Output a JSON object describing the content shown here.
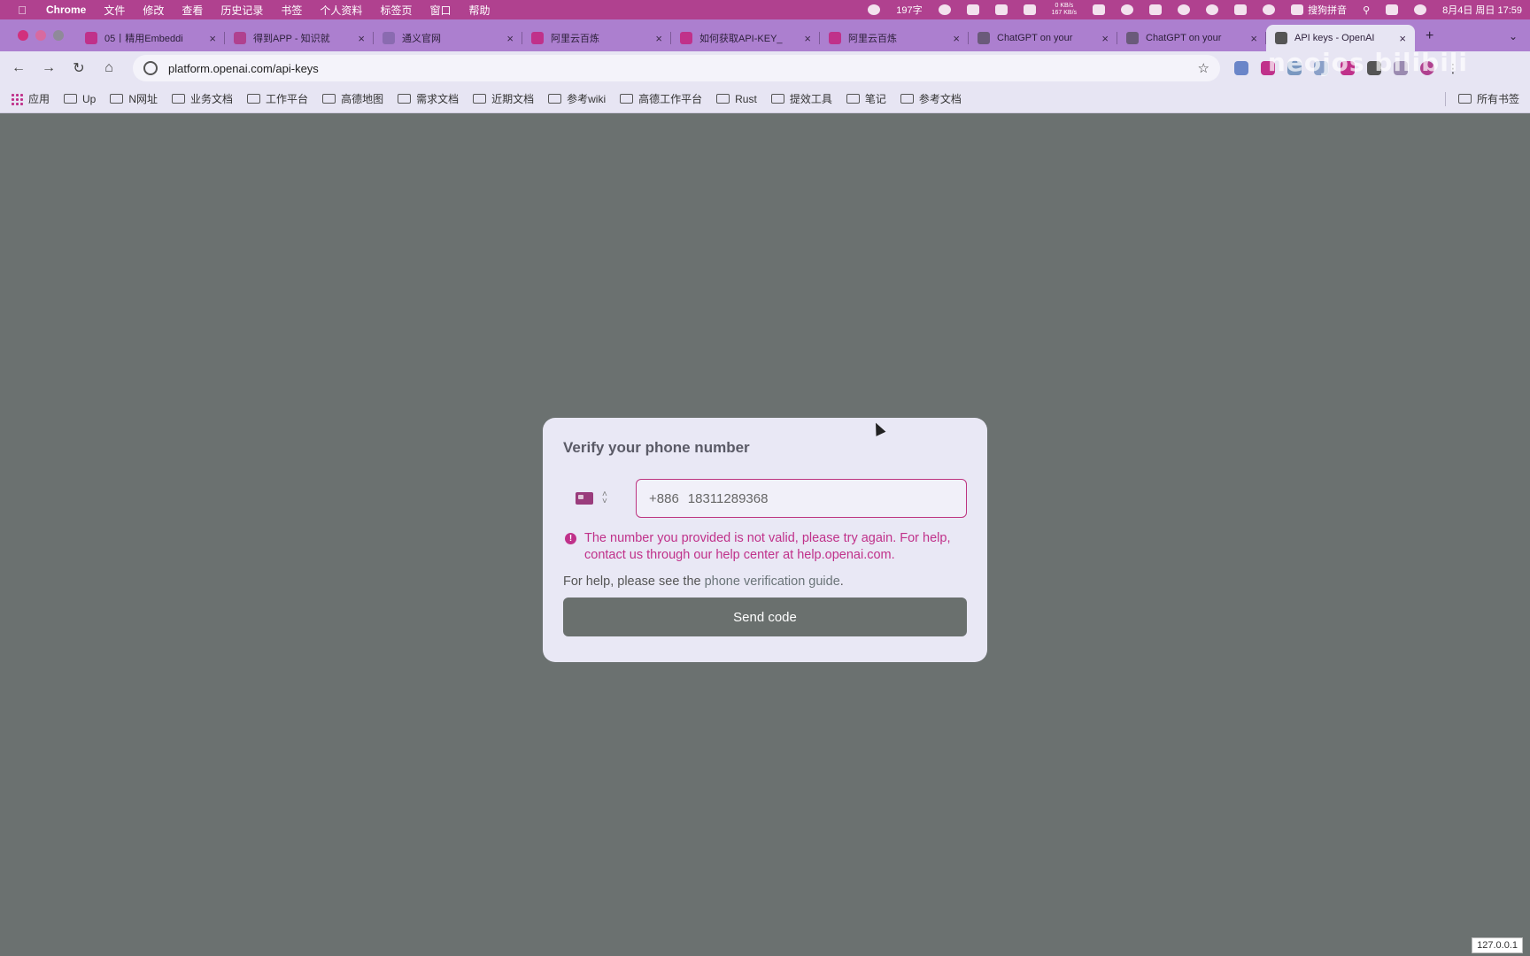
{
  "menubar": {
    "app": "Chrome",
    "items": [
      "文件",
      "修改",
      "查看",
      "历史记录",
      "书签",
      "个人资料",
      "标签页",
      "窗口",
      "帮助"
    ],
    "word_count": "197字",
    "input_method": "搜狗拼音",
    "net_up": "0 KB/s",
    "net_down": "167 KB/s",
    "datetime": "8月4日 周日  17:59"
  },
  "tabs": [
    {
      "title": "05丨精用Embeddi",
      "favicon_color": "#c0318a"
    },
    {
      "title": "得到APP - 知识就",
      "favicon_color": "#b0418f"
    },
    {
      "title": "通义官网",
      "favicon_color": "#8a6bb0"
    },
    {
      "title": "阿里云百炼",
      "favicon_color": "#c0318a"
    },
    {
      "title": "如何获取API-KEY_",
      "favicon_color": "#c0318a"
    },
    {
      "title": "阿里云百炼",
      "favicon_color": "#c0318a"
    },
    {
      "title": "ChatGPT on your",
      "favicon_color": "#6a5a7a"
    },
    {
      "title": "ChatGPT on your",
      "favicon_color": "#6a5a7a"
    },
    {
      "title": "API keys - OpenAI",
      "favicon_color": "#555555"
    }
  ],
  "toolbar": {
    "url": "platform.openai.com/api-keys"
  },
  "bookmarks": {
    "apps": "应用",
    "items": [
      "Up",
      "N网址",
      "业务文档",
      "工作平台",
      "高德地图",
      "需求文档",
      "近期文档",
      "参考wiki",
      "高德工作平台",
      "Rust",
      "提效工具",
      "笔记",
      "参考文档"
    ],
    "all_bookmarks": "所有书签"
  },
  "dialog": {
    "title": "Verify your phone number",
    "country_code": "+886",
    "phone_number": "18311289368",
    "error_message": "The number you provided is not valid, please try again. For help, contact us through our help center at help.openai.com.",
    "help_prefix": "For help, please see the ",
    "help_link": "phone verification guide",
    "help_suffix": ".",
    "button_label": "Send code"
  },
  "ip_badge": "127.0.0.1",
  "colors": {
    "menubar": "#b0418f",
    "error": "#c0318a",
    "button": "#6a706e",
    "backdrop": "#6b7170"
  }
}
